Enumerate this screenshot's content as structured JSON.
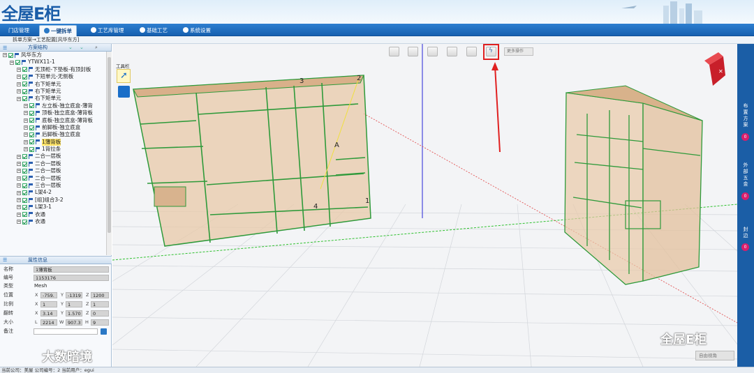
{
  "app": {
    "logo_text": "全屋E柜"
  },
  "nav": {
    "tabs": [
      "门店管理",
      "一键拆单",
      "工艺库管理",
      "基础工艺",
      "系统设置"
    ],
    "active_index": 1
  },
  "breadcrumb": "拆单方案→工艺配置[风华东方]",
  "tree": {
    "panel_title": "方案结构",
    "items": [
      {
        "label": "风华东方",
        "level": 0
      },
      {
        "label": "YTWX11-1",
        "level": 1
      },
      {
        "label": "无顶柜-下垫板-有顶封板",
        "level": 2
      },
      {
        "label": "下短单元-无侧板",
        "level": 2
      },
      {
        "label": "右下矩单元",
        "level": 2
      },
      {
        "label": "右下矩单元",
        "level": 2
      },
      {
        "label": "右下矩单元",
        "level": 2
      },
      {
        "label": "左立板-独立底盒-薄背",
        "level": 3
      },
      {
        "label": "顶板-独立底盒-薄背板",
        "level": 3
      },
      {
        "label": "底板-独立底盒-薄背板",
        "level": 3
      },
      {
        "label": "前脚板-独立底盒",
        "level": 3
      },
      {
        "label": "后脚板-独立底盒",
        "level": 3
      },
      {
        "label": "1薄背板",
        "level": 3,
        "selected": true
      },
      {
        "label": "1背拉条",
        "level": 3
      },
      {
        "label": "二合一层板",
        "level": 2
      },
      {
        "label": "二合一层板",
        "level": 2
      },
      {
        "label": "二合一层板",
        "level": 2
      },
      {
        "label": "二合一层板",
        "level": 2
      },
      {
        "label": "三合一层板",
        "level": 2
      },
      {
        "label": "L架4-2",
        "level": 2
      },
      {
        "label": "[组]组合3-2",
        "level": 2
      },
      {
        "label": "L架3-1",
        "level": 2
      },
      {
        "label": "衣通",
        "level": 2
      },
      {
        "label": "衣通",
        "level": 2
      }
    ]
  },
  "props": {
    "panel_title": "属性信息",
    "name_label": "名称",
    "name_value": "1薄背板",
    "code_label": "编号",
    "code_value": "1153176",
    "type_label": "类型",
    "type_value": "Mesh",
    "pos_label": "位置",
    "pos_x": "-759.",
    "pos_y": "-1319",
    "pos_z": "1200",
    "scale_label": "比例",
    "scale_x": "1",
    "scale_y": "1",
    "scale_z": "1",
    "rot_label": "翻转",
    "rot_x": "3.14",
    "rot_y": "1.570",
    "rot_z": "0",
    "size_label": "大小",
    "size_l": "2214",
    "size_w": "907.3",
    "size_h": "9",
    "note_label": "备注",
    "axis_x": "X",
    "axis_y": "Y",
    "axis_z": "Z",
    "axis_l": "L",
    "axis_w": "W",
    "axis_h": "H"
  },
  "viewport": {
    "tool_label": "工具栏",
    "more_ops": "更多操作",
    "view_select": "自由视角",
    "annotation_labels": [
      "1",
      "2",
      "3",
      "4",
      "A"
    ],
    "view_cube_glyph": "✕"
  },
  "right_sidebar": [
    {
      "label": "布置方案",
      "count": "0"
    },
    {
      "label": "外部五金",
      "count": "0"
    },
    {
      "label": "封边",
      "count": "0"
    }
  ],
  "status_bar": "当前公司：美屋   公司编号：2   当前用户：egui",
  "watermarks": {
    "left": "大数暗境",
    "right": "全屋E柜"
  },
  "colors": {
    "nav": "#1660b0",
    "highlight": "#e02020",
    "cabinet_fill": "#e8c9a8",
    "cabinet_edge": "#2e9a3a",
    "badge": "#d91e6b"
  }
}
